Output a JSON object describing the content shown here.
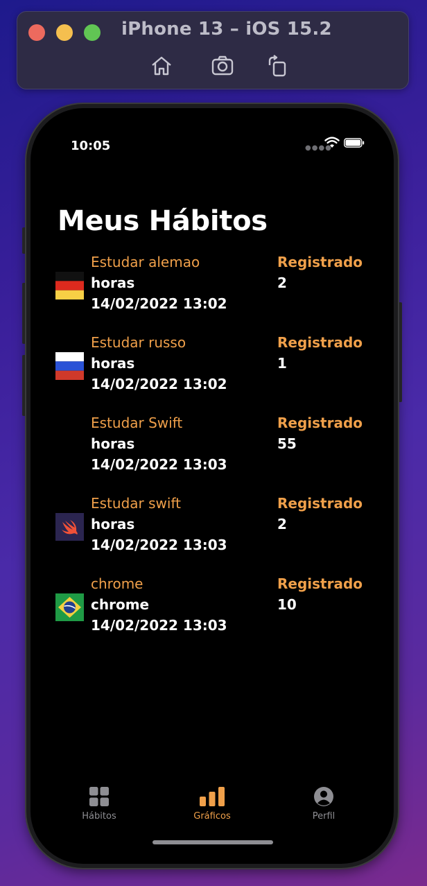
{
  "simulator": {
    "title": "iPhone 13 – iOS 15.2",
    "buttons": [
      "home-icon",
      "screenshot-icon",
      "rotate-icon"
    ]
  },
  "status_bar": {
    "time": "10:05",
    "icons": [
      "signal-dots-icon",
      "wifi-icon",
      "battery-icon"
    ]
  },
  "page": {
    "title": "Meus Hábitos"
  },
  "habits": [
    {
      "name": "Estudar alemao",
      "unit": "horas",
      "date": "14/02/2022 13:02",
      "label": "Registrado",
      "value": "2",
      "icon": "germany-flag-icon"
    },
    {
      "name": "Estudar russo",
      "unit": "horas",
      "date": "14/02/2022 13:02",
      "label": "Registrado",
      "value": "1",
      "icon": "russia-flag-icon"
    },
    {
      "name": "Estudar Swift",
      "unit": "horas",
      "date": "14/02/2022 13:03",
      "label": "Registrado",
      "value": "55",
      "icon": ""
    },
    {
      "name": "Estudar swift",
      "unit": "horas",
      "date": "14/02/2022 13:03",
      "label": "Registrado",
      "value": "2",
      "icon": "swift-logo-icon"
    },
    {
      "name": "chrome",
      "unit": "chrome",
      "date": "14/02/2022 13:03",
      "label": "Registrado",
      "value": "10",
      "icon": "brazil-flag-icon"
    }
  ],
  "tabbar": {
    "tabs": [
      {
        "label": "Hábitos",
        "icon": "grid-icon",
        "active": false
      },
      {
        "label": "Gráficos",
        "icon": "bar-chart-icon",
        "active": true
      },
      {
        "label": "Perfil",
        "icon": "person-circle-icon",
        "active": false
      }
    ]
  },
  "colors": {
    "accent": "#f0a04a",
    "inactive_tab": "#8e8e93",
    "background": "#000000"
  }
}
